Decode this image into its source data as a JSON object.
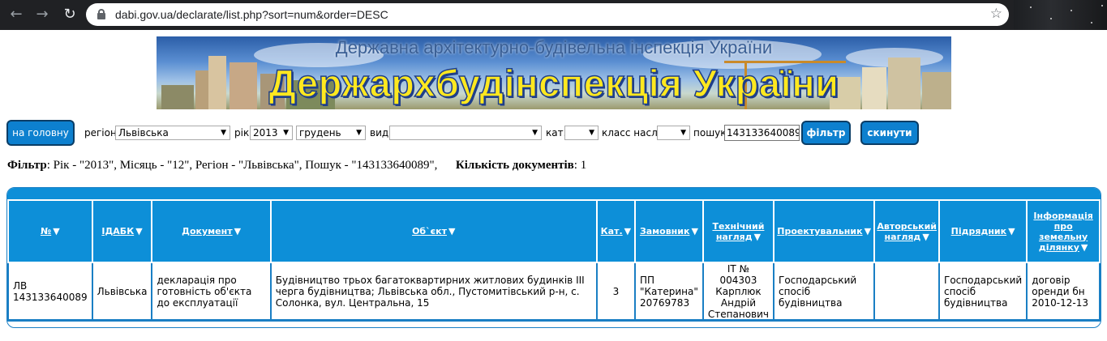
{
  "browser": {
    "url": "dabi.gov.ua/declarate/list.php?sort=num&order=DESC"
  },
  "banner": {
    "subtitle": "Державна архітектурно-будівельна інспекція України",
    "title": "Держархбудінспекція України"
  },
  "filters": {
    "home_label": "на головну",
    "region_label": "регіон",
    "region_value": "Львівська",
    "year_label": "рік",
    "year_value": "2013",
    "month_value": "грудень",
    "type_label": "вид",
    "type_value": "",
    "cat_label": "кат.",
    "cat_value": "",
    "class_label": "класс насл.",
    "class_value": "",
    "search_label": "пошук",
    "search_value": "143133640089",
    "filter_button": "фільтр",
    "reset_button": "скинути"
  },
  "summary": {
    "filter_label": "Фільтр",
    "filter_text": ": Рік - \"2013\", Місяць - \"12\", Регіон - \"Львівська\", Пошук - \"143133640089\",",
    "count_label": "Кількість документів",
    "count_text": ": 1"
  },
  "table": {
    "headers": [
      "№",
      "ІДАБК",
      "Документ",
      "Об`єкт",
      "Кат.",
      "Замовник",
      "Технічний нагляд",
      "Проектувальник",
      "Авторський нагляд",
      "Підрядник",
      "Інформація про земельну ділянку"
    ],
    "rows": [
      {
        "num": "ЛВ 143133640089",
        "idabk": "Львівська",
        "document": "декларація про готовність об'єкта до експлуатації",
        "object": "Будівництво трьох багатоквартирних житлових будинків III черга будівництва; Львівська обл., Пустомитівський р-н, с. Солонка, вул. Центральна, 15",
        "cat": "3",
        "customer": "ПП \"Катерина\" 20769783",
        "tech_supervision": "IT № 004303 Карплюк Андрій Степанович",
        "designer": "Господарський спосіб будівництва",
        "author_supervision": "",
        "contractor": "Господарський спосіб будівництва",
        "land_info": "договір оренди бн 2010-12-13"
      }
    ]
  },
  "colors": {
    "accent": "#0d8fd8",
    "button": "#0d80cf",
    "banner_title": "#ffe81f"
  }
}
